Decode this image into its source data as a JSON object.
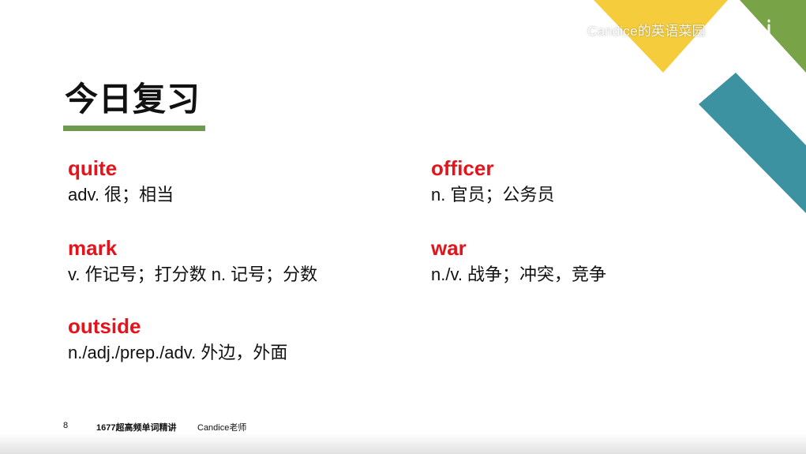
{
  "watermark": {
    "text": "Candice的英语菜园",
    "logo_icon": "bilibili-logo-icon"
  },
  "title": "今日复习",
  "colors": {
    "word": "#e3141b",
    "underline": "#6e9a4f",
    "yellow": "#f5cd3c",
    "green": "#78a347",
    "teal": "#3d92a1"
  },
  "vocab": {
    "quite": {
      "word": "quite",
      "def": "adv. 很；相当"
    },
    "mark": {
      "word": "mark",
      "def": "v. 作记号；打分数  n. 记号；分数"
    },
    "outside": {
      "word": "outside",
      "def": "n./adj./prep./adv.   外边，外面"
    },
    "officer": {
      "word": "officer",
      "def": "n. 官员；公务员"
    },
    "war": {
      "word": "war",
      "def": "n./v. 战争；冲突，竞争"
    }
  },
  "footer": {
    "page": "8",
    "course": "1677超高频单词精讲",
    "teacher": "Candice老师"
  }
}
